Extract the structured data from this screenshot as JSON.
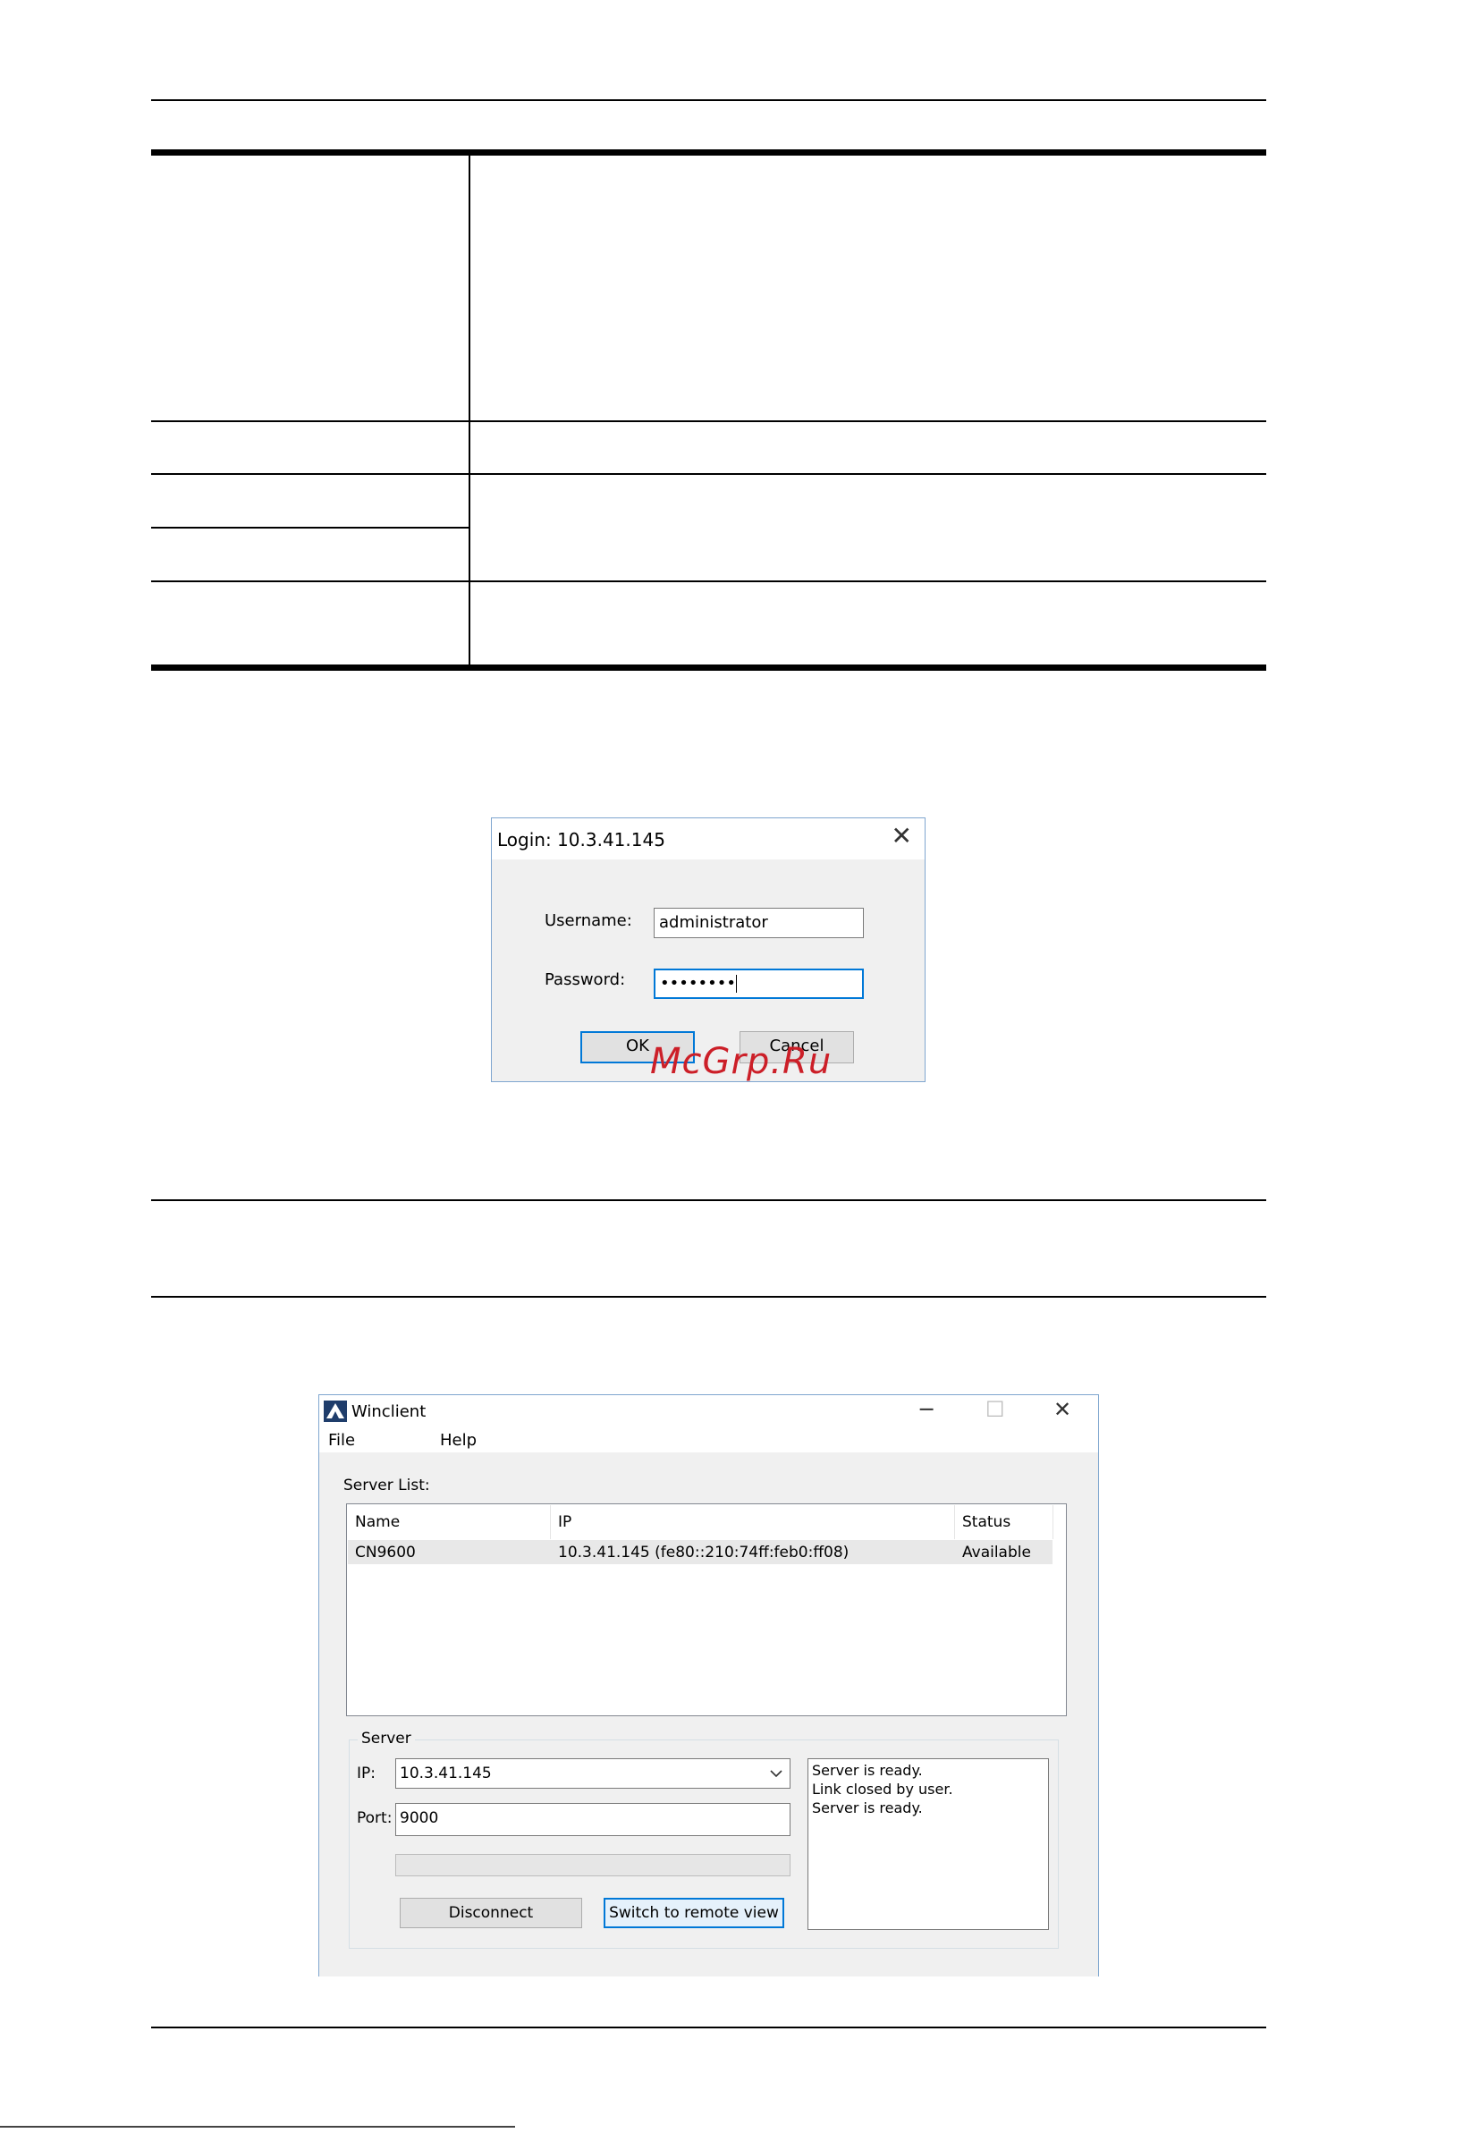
{
  "login_dialog": {
    "title": "Login: 10.3.41.145",
    "close_glyph": "✕",
    "username_label": "Username:",
    "username_value": "administrator",
    "password_label": "Password:",
    "password_value": "••••••••",
    "ok_label": "OK",
    "cancel_label": "Cancel"
  },
  "watermark": "McGrp.Ru",
  "winclient": {
    "title": "Winclient",
    "icons": {
      "app": "winclient-logo-icon",
      "minimize": "─",
      "maximize": "☐",
      "close": "✕"
    },
    "menu": [
      "File",
      "Help"
    ],
    "server_list_label": "Server List:",
    "columns": [
      "Name",
      "IP",
      "Status"
    ],
    "rows": [
      {
        "name": "CN9600",
        "ip": "10.3.41.145 (fe80::210:74ff:feb0:ff08)",
        "status": "Available"
      }
    ],
    "server_group_label": "Server",
    "ip_label": "IP:",
    "ip_value": "10.3.41.145",
    "port_label": "Port:",
    "port_value": "9000",
    "progress": 0,
    "disconnect_label": "Disconnect",
    "switch_label": "Switch to remote view",
    "log_lines": [
      "Server is ready.",
      "Link closed by user.",
      "Server is ready."
    ]
  },
  "colors": {
    "accent": "#0078d7",
    "watermark": "#cc1f28",
    "window_border": "#7fa6cf"
  }
}
